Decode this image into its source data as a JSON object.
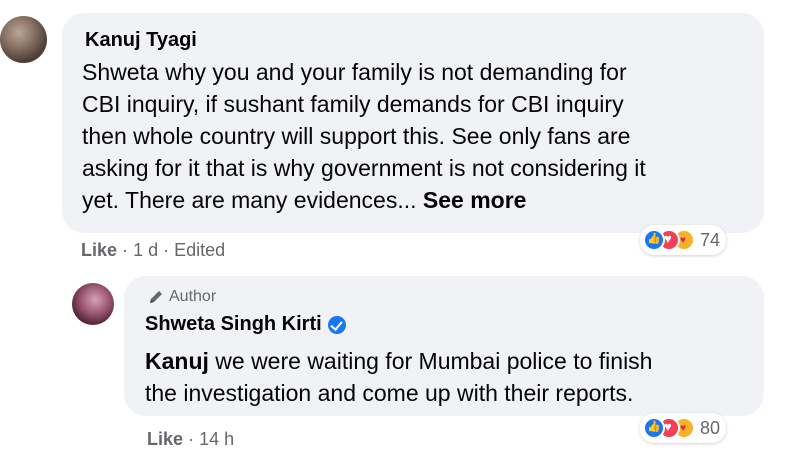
{
  "comments": [
    {
      "author": "Kanuj Tyagi",
      "lines": [
        "Shweta why you and your family is not demanding for",
        "CBI inquiry, if sushant family demands for CBI inquiry",
        "then whole country will support this. See only fans are",
        "asking for it that is why government is not considering it",
        "yet. There are many evidences..."
      ],
      "see_more": "See more",
      "like_label": "Like",
      "time": "1 d",
      "edited": "Edited",
      "separator": "·",
      "reaction_count": "74",
      "reaction_icons": [
        "like-icon",
        "love-icon",
        "care-icon"
      ]
    },
    {
      "badge": "Author",
      "author": "Shweta Singh Kirti",
      "verified": true,
      "mention": "Kanuj",
      "line1_rest": " we were waiting for Mumbai police to finish",
      "line2": "the investigation and come up with their reports.",
      "like_label": "Like",
      "time": "14 h",
      "separator": "·",
      "reaction_count": "80",
      "reaction_icons": [
        "like-icon",
        "love-icon",
        "care-icon"
      ]
    }
  ],
  "colors": {
    "bubble": "#f0f2f5",
    "text": "#050505",
    "meta": "#65676b",
    "verified": "#1877f2"
  }
}
